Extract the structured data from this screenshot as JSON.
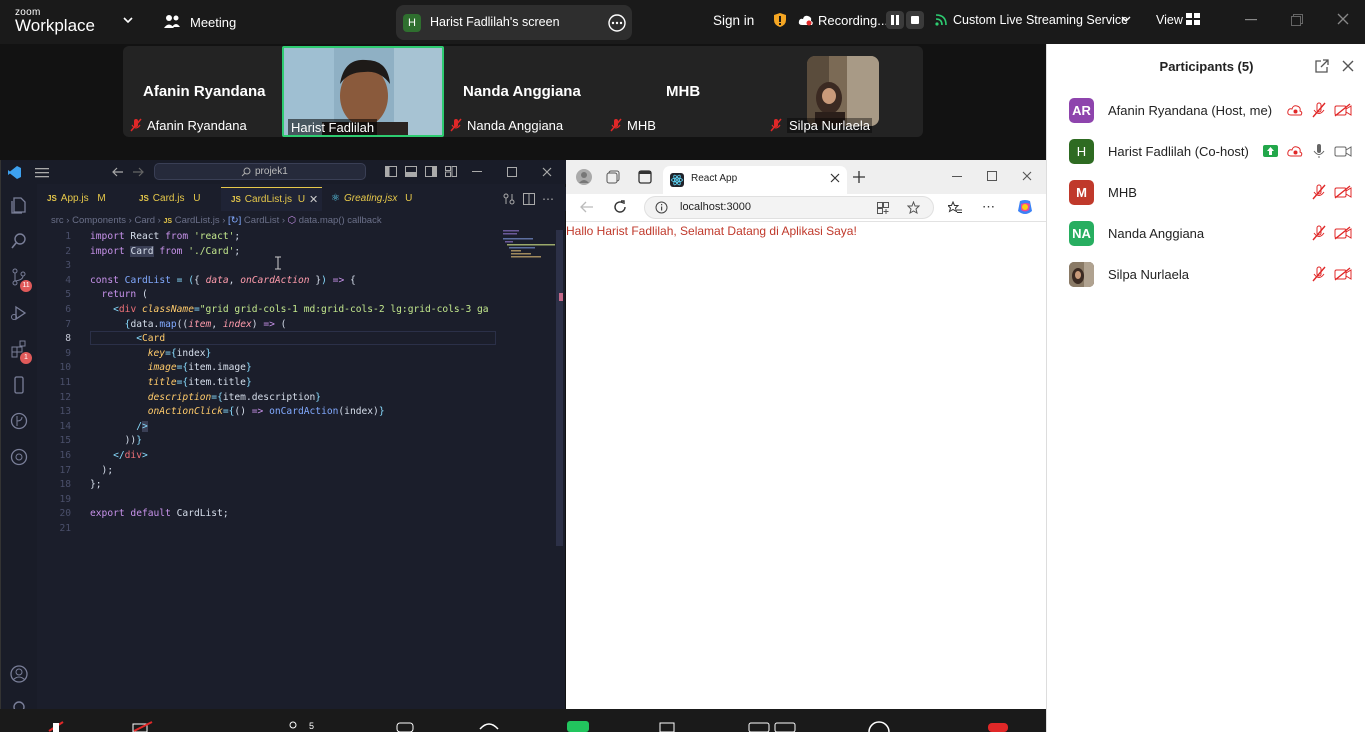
{
  "zoom": {
    "brand_top": "zoom",
    "brand_bottom": "Workplace",
    "meeting_label": "Meeting",
    "screen_share_label": "Harist Fadlilah's screen",
    "screen_share_badge": "H",
    "sign_in": "Sign in",
    "recording": "Recording...",
    "live_streaming": "Custom Live Streaming Service",
    "view": "View"
  },
  "video_strip": {
    "tiles": [
      {
        "display_name": "Afanin Ryandana",
        "label": "Afanin Ryandana",
        "muted": true
      },
      {
        "display_name": "",
        "label": "Harist Fadlilah",
        "muted": false,
        "active_speaker": true
      },
      {
        "display_name": "Nanda  Anggiana",
        "label": "Nanda  Anggiana",
        "muted": true
      },
      {
        "display_name": "MHB",
        "label": "MHB",
        "muted": true
      },
      {
        "display_name": "",
        "label": "Silpa Nurlaela",
        "muted": true
      }
    ]
  },
  "vscode": {
    "search": "projek1",
    "tabs": [
      {
        "icon": "JS",
        "name": "App.js",
        "status": "M"
      },
      {
        "icon": "JS",
        "name": "Card.js",
        "status": "U"
      },
      {
        "icon": "JS",
        "name": "CardList.js",
        "status": "U",
        "active": true
      },
      {
        "icon": "react-icon",
        "name": "Greating.jsx",
        "status": "U"
      }
    ],
    "breadcrumb": [
      "src",
      "Components",
      "Card",
      "CardList.js",
      "CardList",
      "data.map() callback"
    ],
    "badges": {
      "source_control": "11",
      "extensions": "1"
    },
    "line_numbers": [
      "1",
      "2",
      "3",
      "4",
      "5",
      "6",
      "7",
      "8",
      "9",
      "10",
      "11",
      "12",
      "13",
      "14",
      "15",
      "16",
      "17",
      "18",
      "19",
      "20",
      "21"
    ],
    "code_lines": [
      "import React from 'react';",
      "import Card from './Card';",
      "",
      "const CardList = ({ data, onCardAction }) => {",
      "  return (",
      "    <div className=\"grid grid-cols-1 md:grid-cols-2 lg:grid-cols-3 ga",
      "      {data.map((item, index) => (",
      "        <Card",
      "          key={index}",
      "          image={item.image}",
      "          title={item.title}",
      "          description={item.description}",
      "          onActionClick={() => onCardAction(index)}",
      "        />",
      "      ))}",
      "    </div>",
      "  );",
      "};",
      "",
      "export default CardList;",
      ""
    ]
  },
  "browser": {
    "tab_title": "React App",
    "url": "localhost:3000",
    "content": "Hallo Harist Fadlilah, Selamat Datang di Aplikasi Saya!"
  },
  "participants": {
    "title": "Participants (5)",
    "list": [
      {
        "initials": "AR",
        "name": "Afanin Ryandana (Host, me)",
        "color": "#8e44ad"
      },
      {
        "initials": "H",
        "name": "Harist Fadlilah (Co-host)",
        "color": "#2e6b22"
      },
      {
        "initials": "M",
        "name": "MHB",
        "color": "#c0392b"
      },
      {
        "initials": "NA",
        "name": "Nanda  Anggiana",
        "color": "#27ae60"
      },
      {
        "initials": "",
        "name": "Silpa Nurlaela",
        "color": "#6b5a4a"
      }
    ]
  },
  "colors": {
    "zoom_dark": "#1a1a1a",
    "active_speaker": "#2ecc71",
    "muted_red": "#e02828",
    "hello_text": "#c0392b"
  }
}
